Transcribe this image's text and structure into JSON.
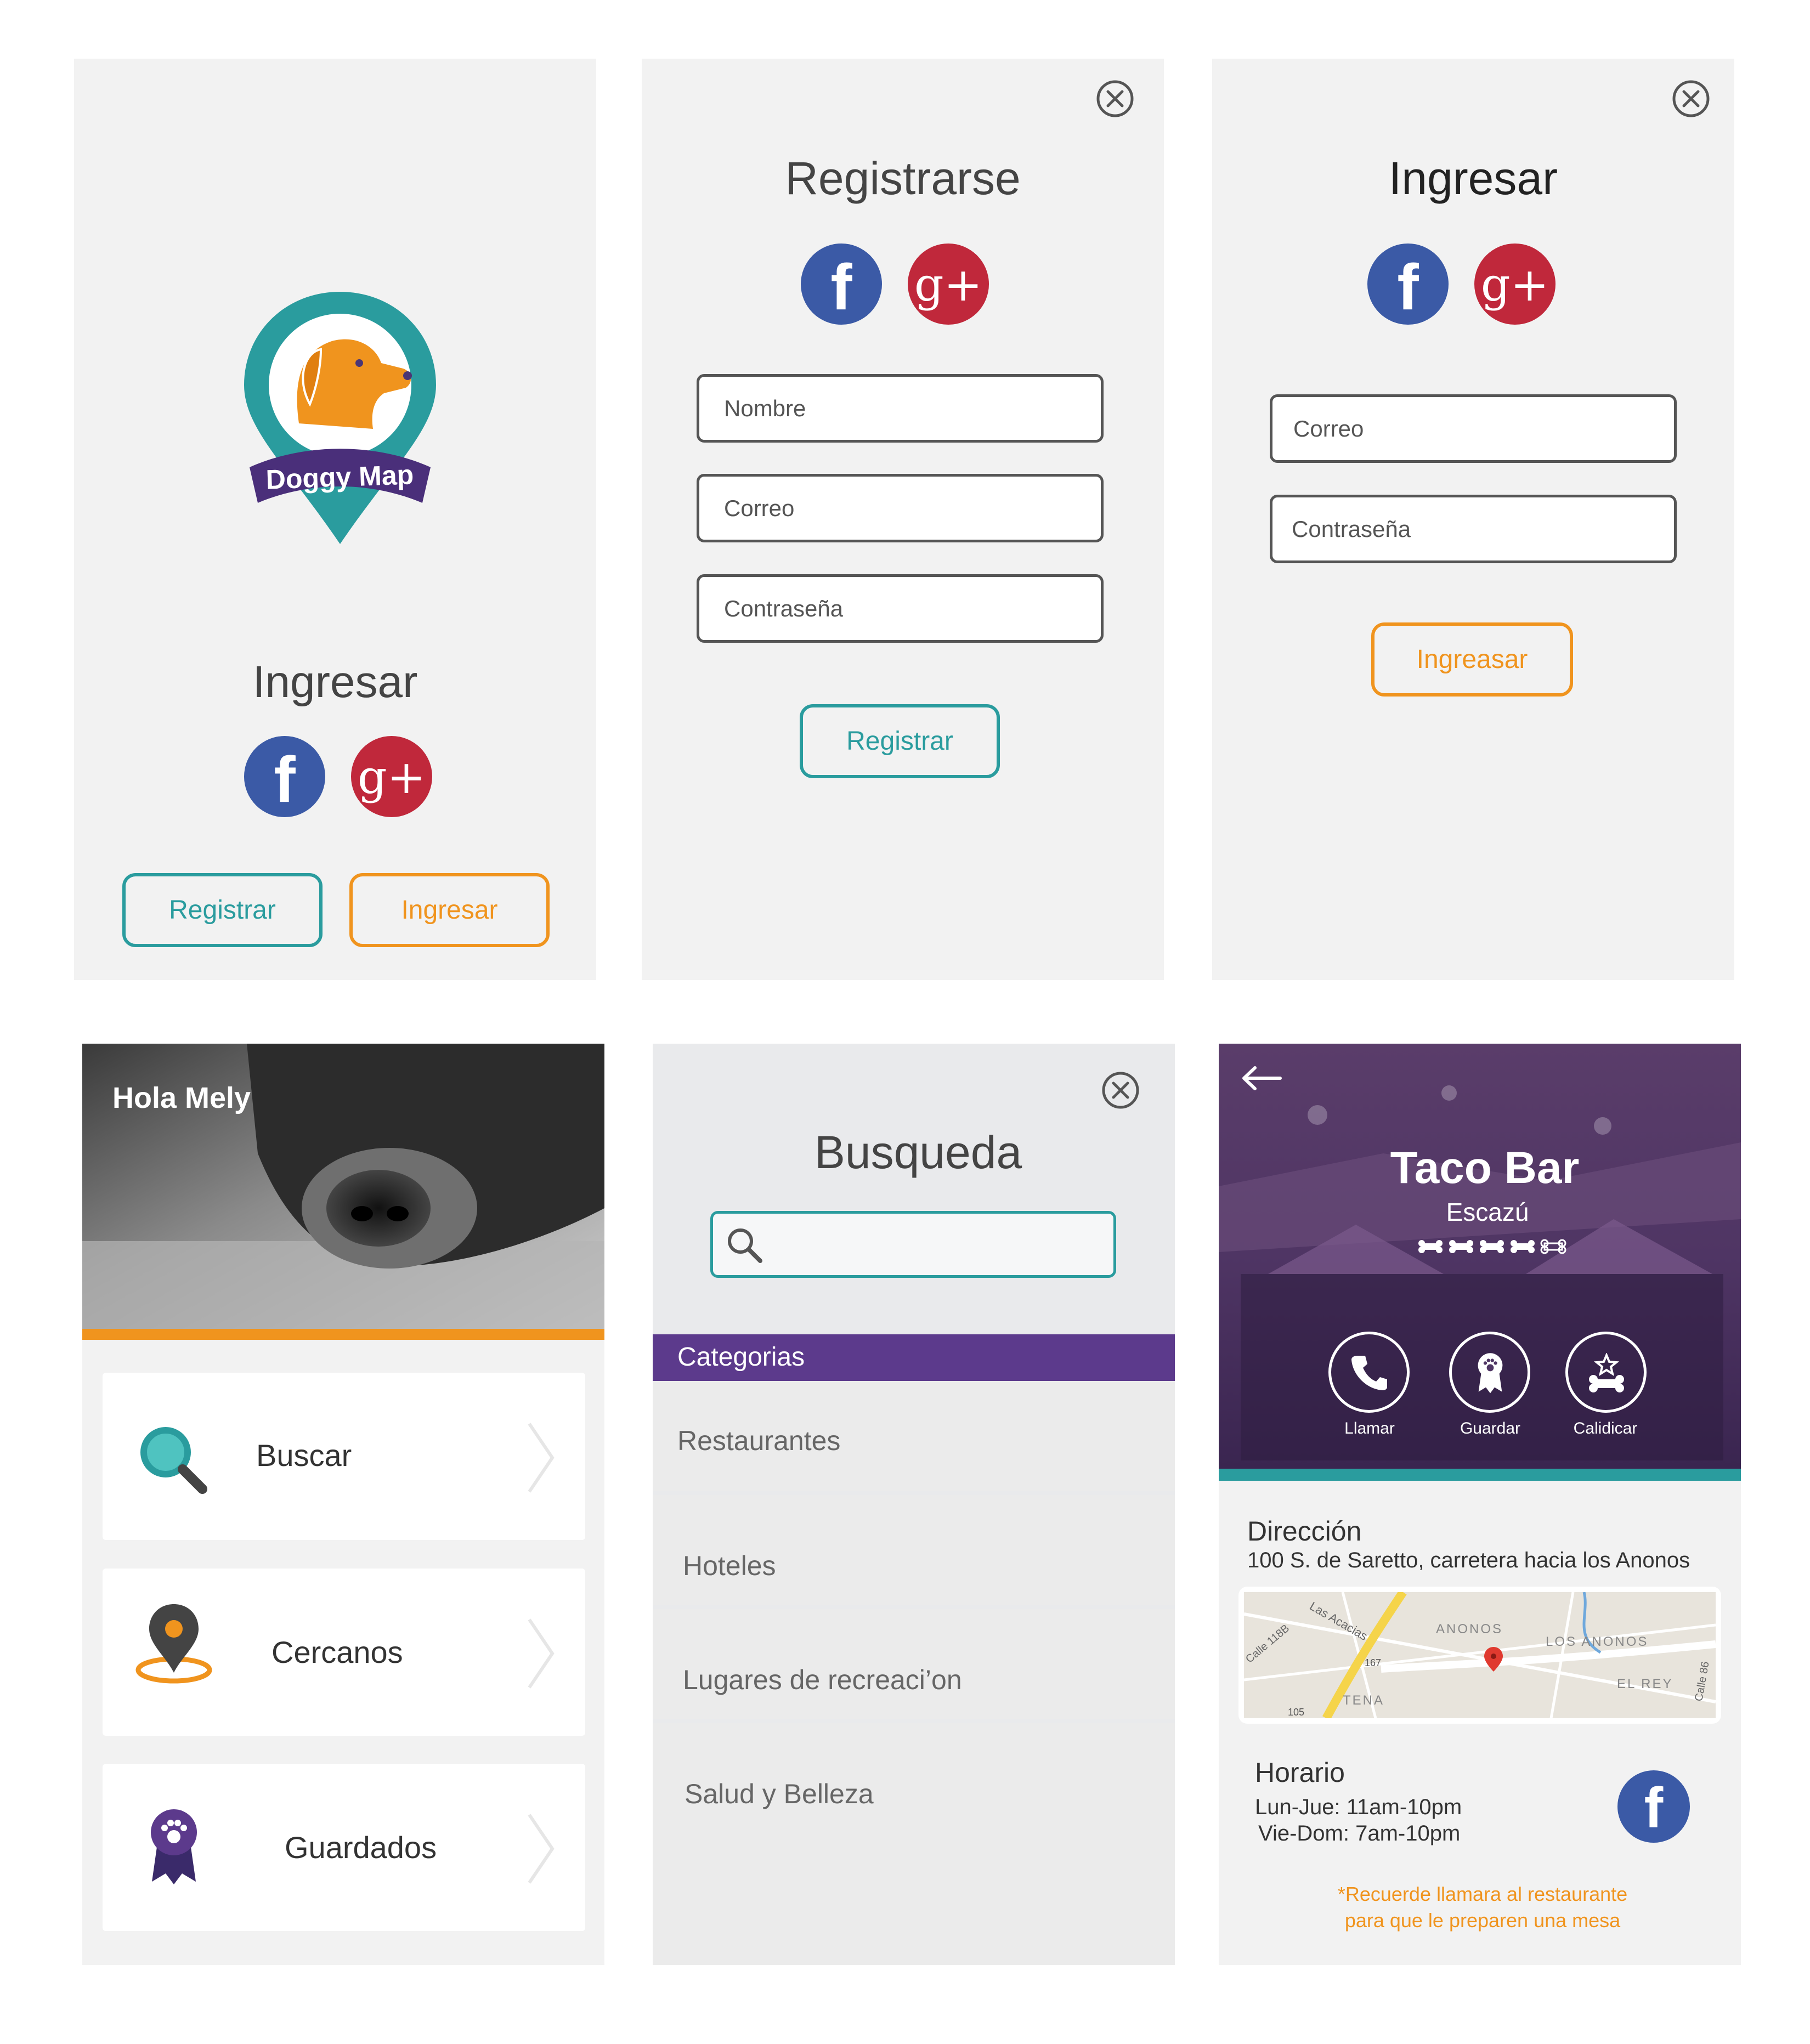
{
  "colors": {
    "teal": "#2a9c9e",
    "orange": "#f0941e",
    "purple": "#5c3a8c",
    "facebook": "#3b5aa6",
    "google_plus": "#c0283b",
    "panel_gray": "#f2f2f2"
  },
  "screen1": {
    "logo_text": "Doggy Map",
    "title": "Ingresar",
    "register_button": "Registrar",
    "login_button": "Ingresar",
    "facebook_glyph": "f",
    "google_glyph": "g+"
  },
  "screen2": {
    "title": "Registrarse",
    "name_placeholder": "Nombre",
    "email_placeholder": "Correo",
    "password_placeholder": "Contraseña",
    "submit_button": "Registrar",
    "close_icon": "close-icon",
    "facebook_glyph": "f",
    "google_glyph": "g+"
  },
  "screen3": {
    "title": "Ingresar",
    "email_placeholder": "Correo",
    "password_placeholder": "Contraseña",
    "submit_button": "Ingreasar",
    "close_icon": "close-icon",
    "facebook_glyph": "f",
    "google_glyph": "g+"
  },
  "screen4": {
    "greeting": "Hola Mely",
    "menu": [
      {
        "label": "Buscar",
        "icon": "search-icon"
      },
      {
        "label": "Cercanos",
        "icon": "location-pin-icon"
      },
      {
        "label": "Guardados",
        "icon": "paw-ribbon-icon"
      }
    ]
  },
  "screen5": {
    "title": "Busqueda",
    "search_value": "",
    "categories_header": "Categorias",
    "categories": [
      "Restaurantes",
      "Hoteles",
      "Lugares de recreaci’on",
      "Salud y Belleza"
    ]
  },
  "screen6": {
    "name": "Taco Bar",
    "location": "Escazú",
    "rating": 4,
    "rating_max": 5,
    "actions": [
      {
        "label": "Llamar",
        "icon": "phone-icon"
      },
      {
        "label": "Guardar",
        "icon": "paw-ribbon-icon"
      },
      {
        "label": "Calidicar",
        "icon": "bone-star-icon"
      }
    ],
    "address_label": "Dirección",
    "address": "100 S. de Saretto, carretera hacia los Anonos",
    "map_labels": [
      "Las Acacias",
      "ANONOS",
      "LOS ANONOS",
      "EL REY",
      "TENA",
      "Calle 118B",
      "Calle 86",
      "167",
      "105"
    ],
    "hours_label": "Horario",
    "hours": [
      "Lun-Jue: 11am-10pm",
      "Vie-Dom: 7am-10pm"
    ],
    "note_lines": [
      "*Recuerde llamara al restaurante",
      "para que le preparen una mesa"
    ],
    "facebook_glyph": "f"
  }
}
